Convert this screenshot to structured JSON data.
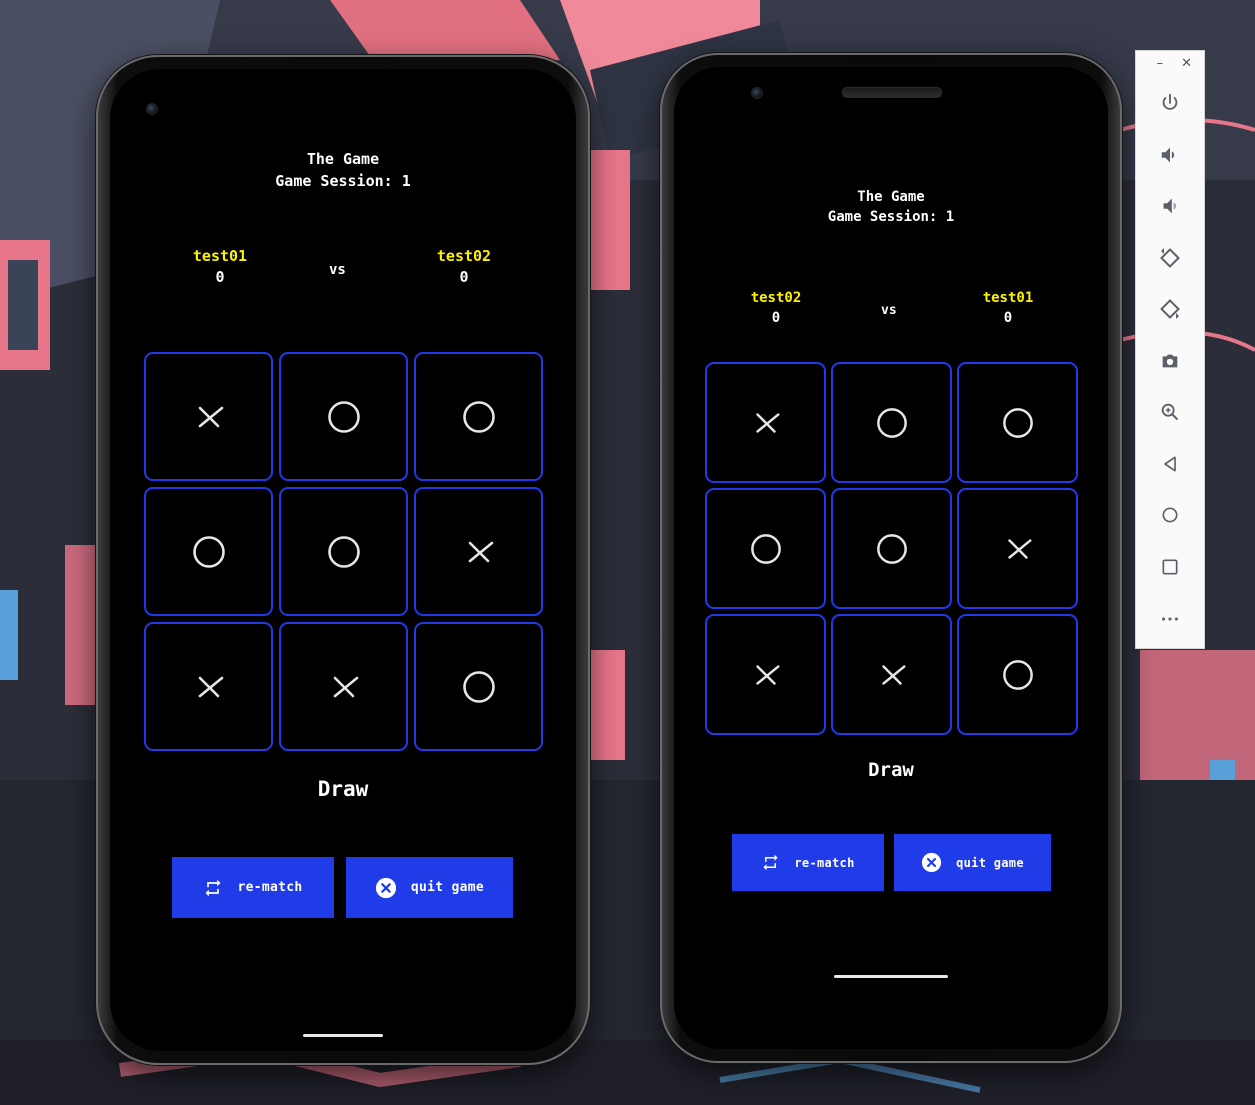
{
  "theme": {
    "cell_border": "#2339e6",
    "button_bg": "#1f3ce8",
    "player_name_color": "#fff200",
    "mark_color": "#e6e6e6"
  },
  "toolbar": {
    "items": [
      "power-icon",
      "volume-up-icon",
      "volume-down-icon",
      "rotate-left-icon",
      "rotate-right-icon",
      "camera-icon",
      "zoom-icon",
      "back-icon",
      "home-icon",
      "overview-icon",
      "more-icon"
    ]
  },
  "phones": [
    {
      "header": {
        "title": "The Game",
        "session": "Game Session: 1"
      },
      "player_left": {
        "name": "test01",
        "score": "0"
      },
      "vs": "vs",
      "player_right": {
        "name": "test02",
        "score": "0"
      },
      "board": [
        "X",
        "O",
        "O",
        "O",
        "O",
        "X",
        "X",
        "X",
        "O"
      ],
      "result": "Draw",
      "rematch_label": "re-match",
      "quit_label": "quit game"
    },
    {
      "header": {
        "title": "The Game",
        "session": "Game Session: 1"
      },
      "player_left": {
        "name": "test02",
        "score": "0"
      },
      "vs": "vs",
      "player_right": {
        "name": "test01",
        "score": "0"
      },
      "board": [
        "X",
        "O",
        "O",
        "O",
        "O",
        "X",
        "X",
        "X",
        "O"
      ],
      "result": "Draw",
      "rematch_label": "re-match",
      "quit_label": "quit game"
    }
  ]
}
